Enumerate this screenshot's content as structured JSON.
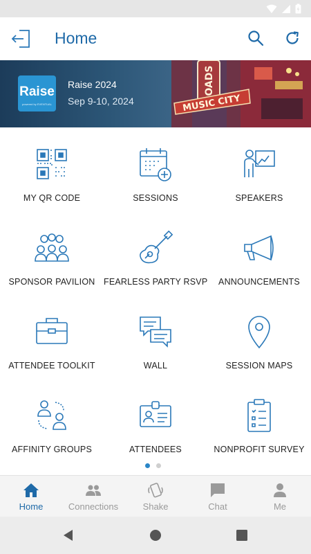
{
  "header": {
    "title": "Home"
  },
  "banner": {
    "logo_text": "Raise",
    "logo_subtext": "powered by EVENTUAL",
    "event_name": "Raise 2024",
    "event_date": "Sep 9-10, 2024",
    "sign_text_1": "ROADS",
    "sign_text_2": "MUSIC CITY"
  },
  "tiles": [
    {
      "label": "MY QR CODE",
      "icon": "qr-code-icon"
    },
    {
      "label": "SESSIONS",
      "icon": "calendar-plus-icon"
    },
    {
      "label": "SPEAKERS",
      "icon": "presenter-icon"
    },
    {
      "label": "SPONSOR PAVILION",
      "icon": "group-icon"
    },
    {
      "label": "FEARLESS PARTY RSVP",
      "icon": "guitar-icon"
    },
    {
      "label": "ANNOUNCEMENTS",
      "icon": "megaphone-icon"
    },
    {
      "label": "ATTENDEE TOOLKIT",
      "icon": "toolbox-icon"
    },
    {
      "label": "WALL",
      "icon": "chat-bubbles-icon"
    },
    {
      "label": "SESSION MAPS",
      "icon": "map-pin-icon"
    },
    {
      "label": "AFFINITY GROUPS",
      "icon": "people-connect-icon"
    },
    {
      "label": "ATTENDEES",
      "icon": "badge-icon"
    },
    {
      "label": "NONPROFIT SURVEY",
      "icon": "clipboard-icon"
    }
  ],
  "pager": {
    "total": 2,
    "active": 1
  },
  "nav": [
    {
      "label": "Home",
      "icon": "home-icon",
      "active": true
    },
    {
      "label": "Connections",
      "icon": "people-icon"
    },
    {
      "label": "Shake",
      "icon": "shake-icon"
    },
    {
      "label": "Chat",
      "icon": "chat-icon"
    },
    {
      "label": "Me",
      "icon": "person-icon"
    }
  ],
  "colors": {
    "accent": "#1f6aa8",
    "icon_stroke": "#2a78b8",
    "inactive": "#9a9a9a"
  }
}
